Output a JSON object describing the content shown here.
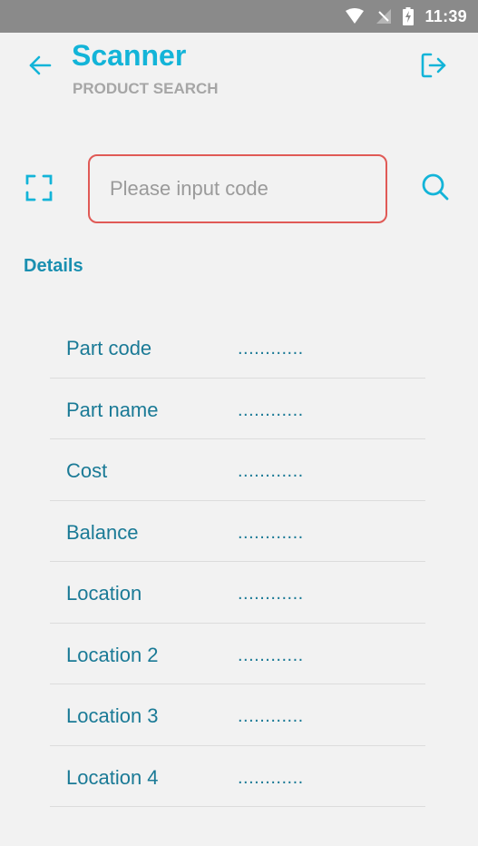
{
  "status_bar": {
    "time": "11:39",
    "icons": [
      "wifi-icon",
      "no-signal-icon",
      "battery-charging-icon"
    ]
  },
  "header": {
    "title": "Scanner",
    "subtitle": "PRODUCT SEARCH",
    "back_icon": "arrow-left-icon",
    "logout_icon": "logout-icon"
  },
  "search": {
    "placeholder": "Please input code",
    "value": "",
    "scan_icon": "scan-frame-icon",
    "search_icon": "search-icon"
  },
  "details": {
    "heading": "Details",
    "rows": [
      {
        "label": "Part code",
        "value": "............"
      },
      {
        "label": "Part name",
        "value": "............"
      },
      {
        "label": "Cost",
        "value": "............"
      },
      {
        "label": "Balance",
        "value": "............"
      },
      {
        "label": "Location",
        "value": "............"
      },
      {
        "label": "Location 2",
        "value": "............"
      },
      {
        "label": "Location 3",
        "value": "............"
      },
      {
        "label": "Location 4",
        "value": "............"
      }
    ]
  },
  "colors": {
    "accent": "#13b4d8",
    "label": "#1a7a96",
    "input_border": "#e05a56",
    "background": "#f2f2f2",
    "status_bar": "#8a8a8a"
  }
}
